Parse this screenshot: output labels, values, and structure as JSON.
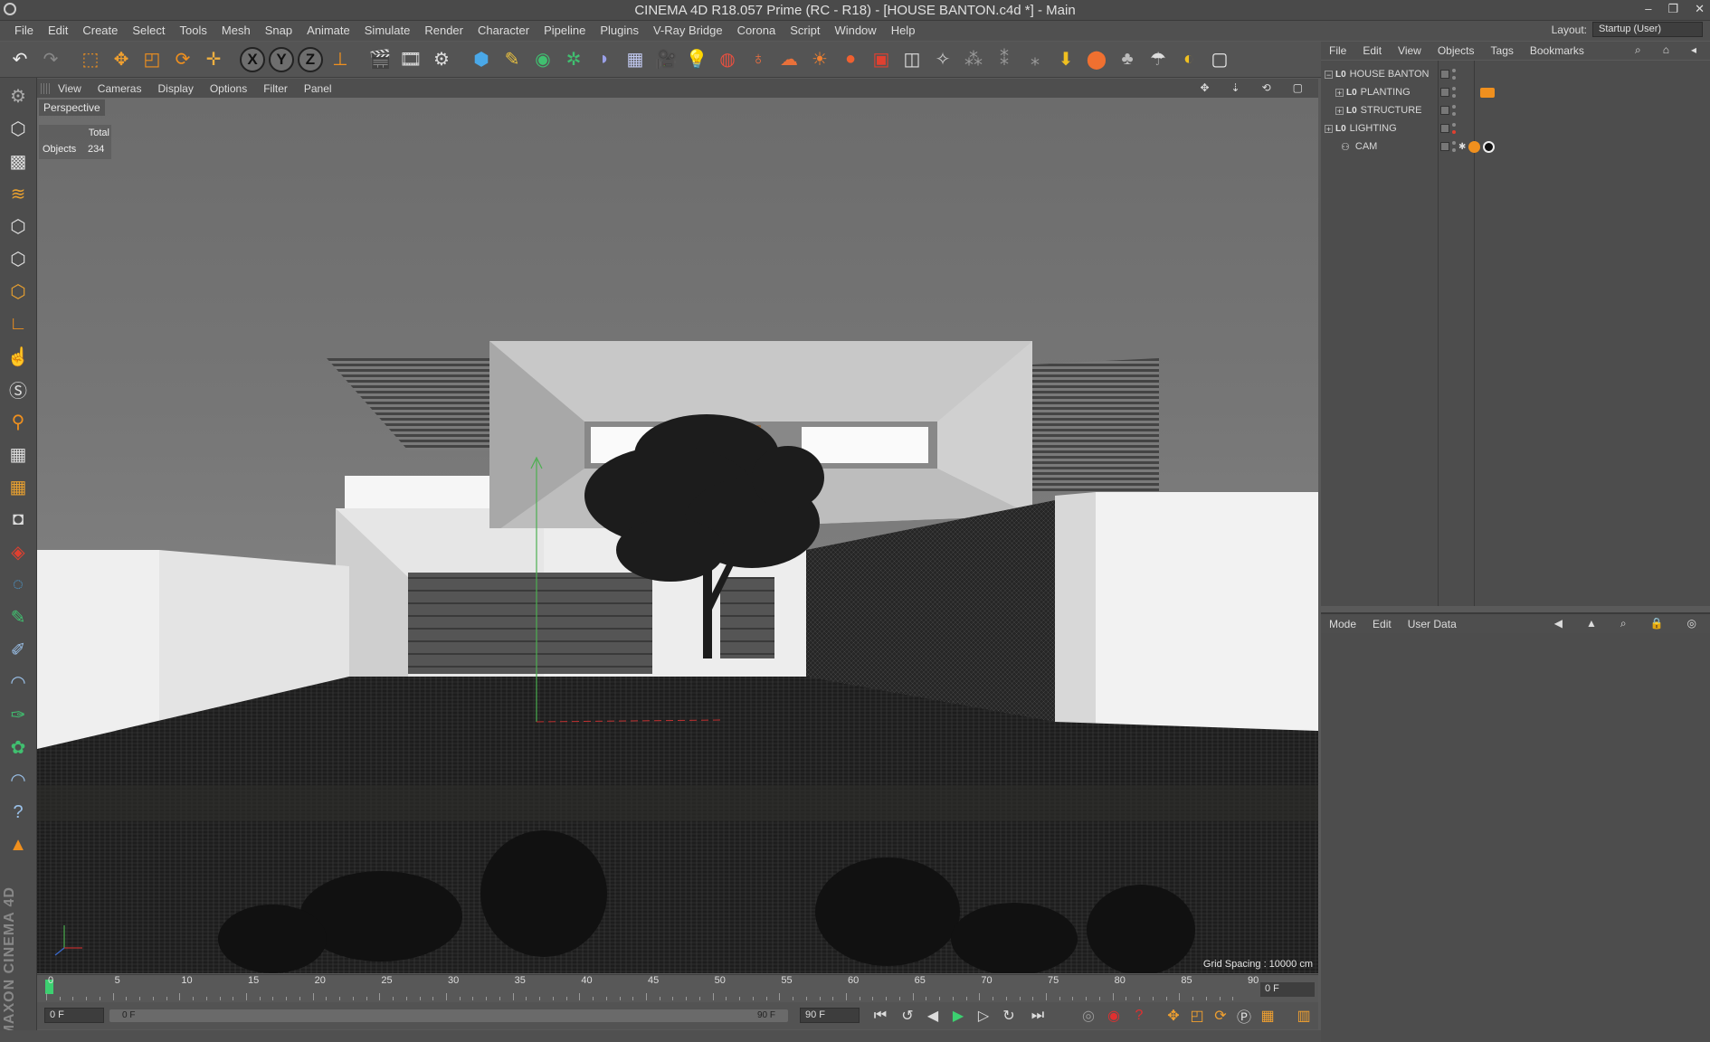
{
  "window": {
    "title": "CINEMA 4D R18.057 Prime (RC - R18) - [HOUSE BANTON.c4d *] - Main",
    "controls": [
      "–",
      "❐",
      "✕"
    ]
  },
  "menubar": {
    "items": [
      "File",
      "Edit",
      "Create",
      "Select",
      "Tools",
      "Mesh",
      "Snap",
      "Animate",
      "Simulate",
      "Render",
      "Character",
      "Pipeline",
      "Plugins",
      "V-Ray Bridge",
      "Corona",
      "Script",
      "Window",
      "Help"
    ],
    "layout_label": "Layout:",
    "layout_value": "Startup (User)"
  },
  "viewport": {
    "menu": [
      "View",
      "Cameras",
      "Display",
      "Options",
      "Filter",
      "Panel"
    ],
    "camera_label": "Perspective",
    "stats": {
      "header": "Total",
      "label": "Objects",
      "value": "234"
    },
    "grid_spacing": "Grid Spacing : 10000 cm"
  },
  "timeline": {
    "ticks": [
      "0",
      "5",
      "10",
      "15",
      "20",
      "25",
      "30",
      "35",
      "40",
      "45",
      "50",
      "55",
      "60",
      "65",
      "70",
      "75",
      "80",
      "85",
      "90"
    ],
    "current_frame": "0 F"
  },
  "transport": {
    "start_field": "0 F",
    "range_start": "0 F",
    "range_end": "90 F",
    "end_field": "90 F"
  },
  "object_manager": {
    "menu": [
      "File",
      "Edit",
      "View",
      "Objects",
      "Tags",
      "Bookmarks"
    ],
    "objects": [
      {
        "name": "HOUSE BANTON",
        "type": "layer-null-icon",
        "expanded": true,
        "level": 0
      },
      {
        "name": "PLANTING",
        "type": "layer-null-icon",
        "expanded": false,
        "level": 1
      },
      {
        "name": "STRUCTURE",
        "type": "layer-null-icon",
        "expanded": false,
        "level": 1
      },
      {
        "name": "LIGHTING",
        "type": "layer-null-icon",
        "expanded": false,
        "level": 0
      },
      {
        "name": "CAM",
        "type": "camera-icon",
        "expanded": false,
        "level": 1
      }
    ]
  },
  "attribute_manager": {
    "menu": [
      "Mode",
      "Edit",
      "User Data"
    ]
  },
  "branding": {
    "logo_text": "MAXON CINEMA 4D"
  },
  "colors": {
    "accent_orange": "#f0901e",
    "playhead_green": "#3cd070",
    "axis_y_green": "#4caf50"
  }
}
